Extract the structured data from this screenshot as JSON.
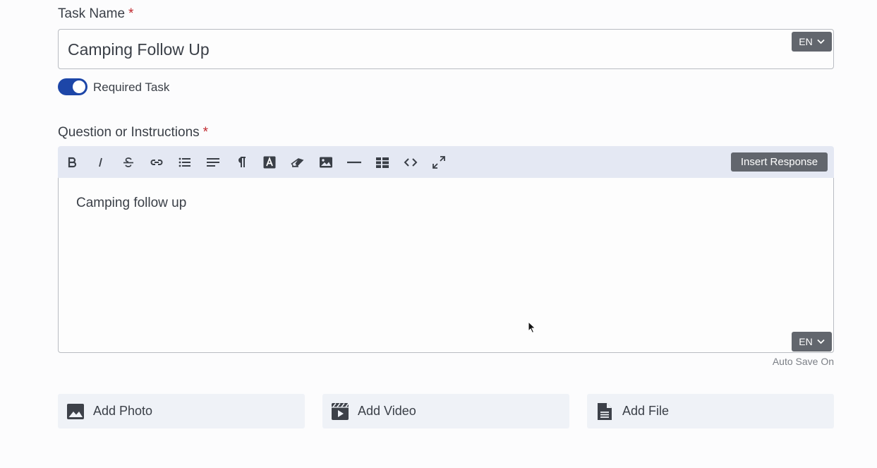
{
  "task_name": {
    "label": "Task Name",
    "required_mark": "*",
    "value": "Camping Follow Up",
    "lang": "EN"
  },
  "required_toggle": {
    "label": "Required Task",
    "on": true,
    "color": "#1d46a8"
  },
  "instructions": {
    "label": "Question or Instructions",
    "required_mark": "*",
    "toolbar": {
      "icons": [
        "bold-icon",
        "italic-icon",
        "strikethrough-icon",
        "link-icon",
        "bulleted-list-icon",
        "align-icon",
        "paragraph-icon",
        "text-color-icon",
        "eraser-icon",
        "image-icon",
        "horizontal-rule-icon",
        "table-icon",
        "code-icon",
        "fullscreen-icon"
      ],
      "insert_response_label": "Insert Response"
    },
    "content": "Camping follow up",
    "lang": "EN",
    "autosave": "Auto Save On"
  },
  "media": {
    "add_photo": "Add Photo",
    "add_video": "Add Video",
    "add_file": "Add File"
  }
}
